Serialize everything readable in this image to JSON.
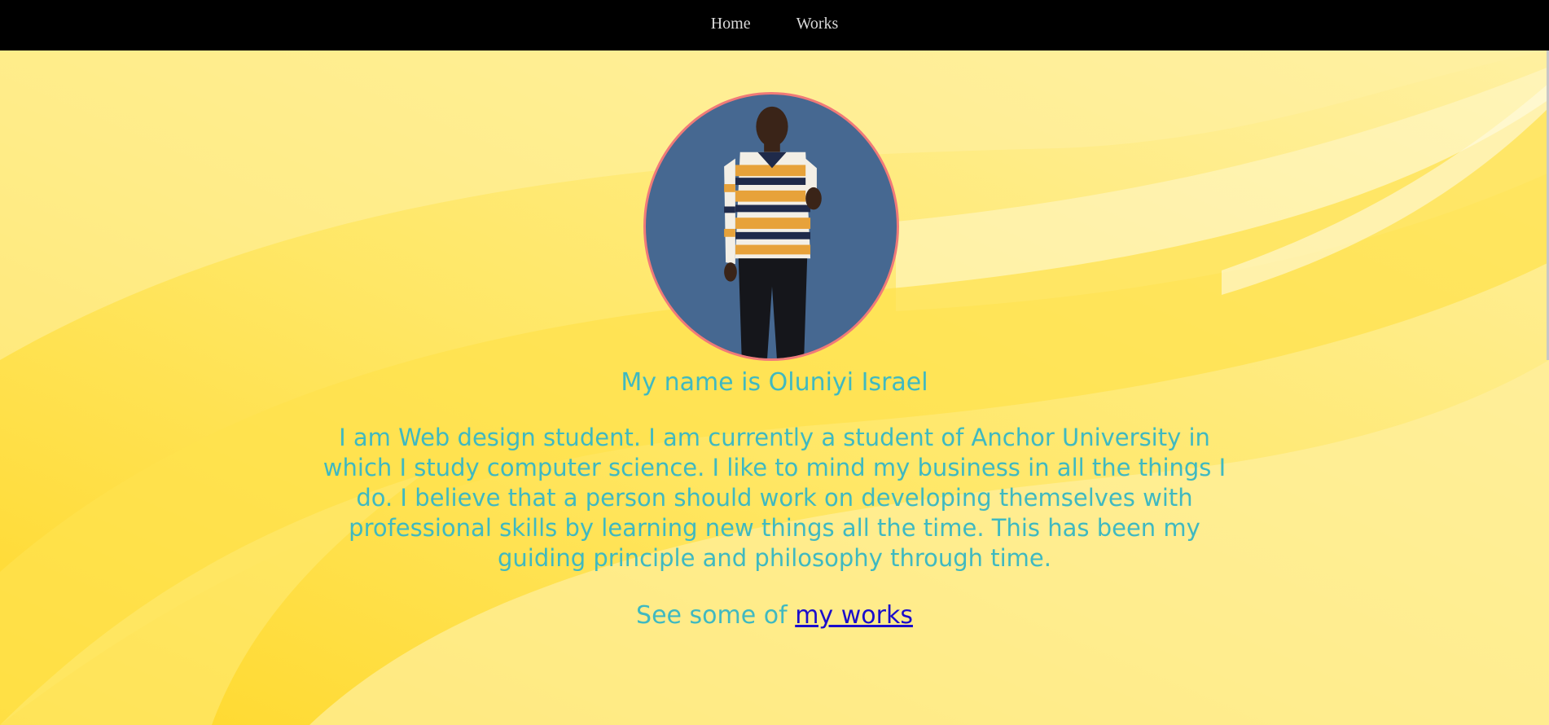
{
  "nav": {
    "items": [
      {
        "label": "Home"
      },
      {
        "label": "Works"
      }
    ]
  },
  "profile": {
    "headline": "My name is Oluniyi Israel",
    "bio": "I am Web design student. I am currently a student of Anchor University in which I study computer science. I like to mind my business in all the things I do. I believe that a person should work on developing themselves with professional skills by learning new things all the time. This has been my guiding principle and philosophy through time.",
    "cta_prefix": "See some of ",
    "cta_link": "my works"
  },
  "colors": {
    "nav_bg": "#000000",
    "nav_text": "#d9d9d9",
    "text_teal": "#3fb9c1",
    "link_blue": "#1a0dcc",
    "avatar_border": "#f07a78",
    "avatar_bg": "#466891",
    "yellow_light": "#fff3b0",
    "yellow_mid": "#ffe45c",
    "yellow_deep": "#ffd92a"
  },
  "icons": {
    "avatar": "person-photo"
  }
}
